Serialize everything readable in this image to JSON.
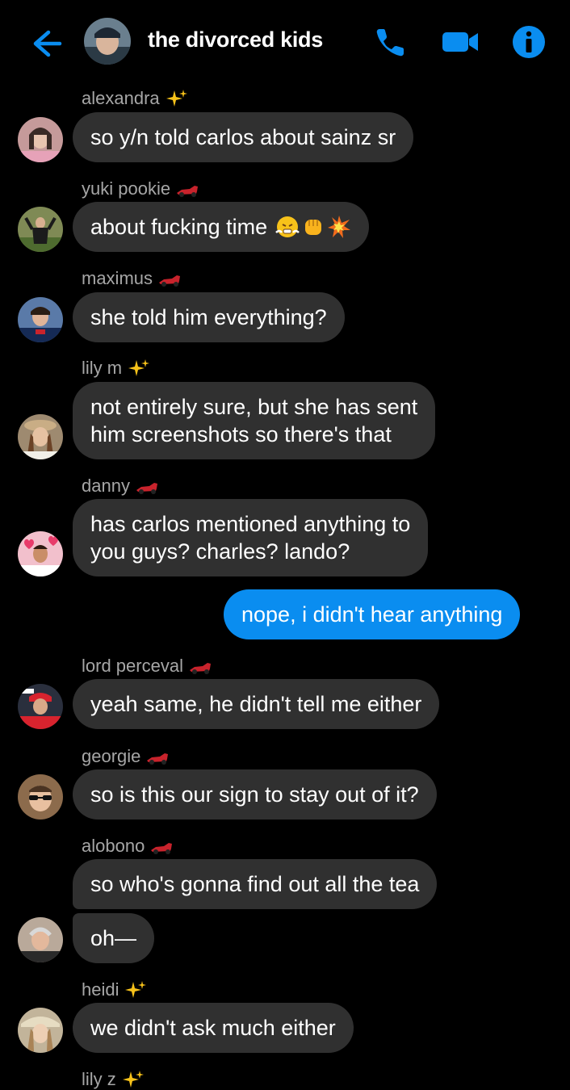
{
  "header": {
    "title": "the divorced kids",
    "accent": "#0a8df0"
  },
  "icons": {
    "back": "arrow-left-icon",
    "call": "phone-icon",
    "video": "video-camera-icon",
    "info": "info-icon"
  },
  "colors": {
    "background": "#000000",
    "bubble_other": "#303030",
    "bubble_mine": "#0a8df0",
    "sender_name": "#a6a6a6"
  },
  "messages": [
    {
      "sender": "alexandra",
      "badge": "sparkles",
      "text": [
        "so y/n told carlos about sainz sr"
      ]
    },
    {
      "sender": "yuki pookie",
      "badge": "race-car",
      "text": [
        "about fucking time"
      ],
      "emojis": [
        "steam-face",
        "fist",
        "collision"
      ]
    },
    {
      "sender": "maximus",
      "badge": "race-car",
      "text": [
        "she told him everything?"
      ]
    },
    {
      "sender": "lily m",
      "badge": "sparkles",
      "text": [
        "not entirely sure, but she has sent",
        "him screenshots so there's that"
      ]
    },
    {
      "sender": "danny",
      "badge": "race-car",
      "text": [
        "has carlos mentioned anything to",
        "you guys? charles? lando?"
      ]
    },
    {
      "sender": "me",
      "text": [
        "nope, i didn't hear anything"
      ]
    },
    {
      "sender": "lord perceval",
      "badge": "race-car",
      "text": [
        "yeah same, he didn't tell me either"
      ]
    },
    {
      "sender": "georgie",
      "badge": "race-car",
      "text": [
        "so is this our sign to stay out of it?"
      ]
    },
    {
      "sender": "alobono",
      "badge": "race-car",
      "text": [
        "so who's gonna find out all the tea"
      ]
    },
    {
      "sender": "alobono",
      "text": [
        "oh—"
      ]
    },
    {
      "sender": "heidi",
      "badge": "sparkles",
      "text": [
        "we didn't ask much either"
      ]
    },
    {
      "sender": "lily z",
      "badge": "sparkles"
    }
  ]
}
